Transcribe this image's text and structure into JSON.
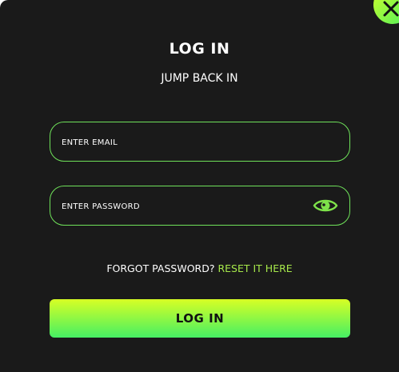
{
  "dialog": {
    "title": "LOG IN",
    "subtitle": "JUMP BACK IN"
  },
  "email": {
    "placeholder": "ENTER EMAIL",
    "value": ""
  },
  "password": {
    "placeholder": "ENTER PASSWORD",
    "value": "",
    "toggle_icon": "eye-icon"
  },
  "forgot": {
    "prompt": "FORGOT PASSWORD?",
    "link": "RESET IT HERE"
  },
  "submit": {
    "label": "LOG IN"
  },
  "close": {
    "icon": "close-icon"
  },
  "colors": {
    "background": "#1a1a1a",
    "accent_start": "#d8ff24",
    "accent_end": "#45ef64",
    "link": "#a6e84a",
    "field_border": "#6fe25a"
  }
}
